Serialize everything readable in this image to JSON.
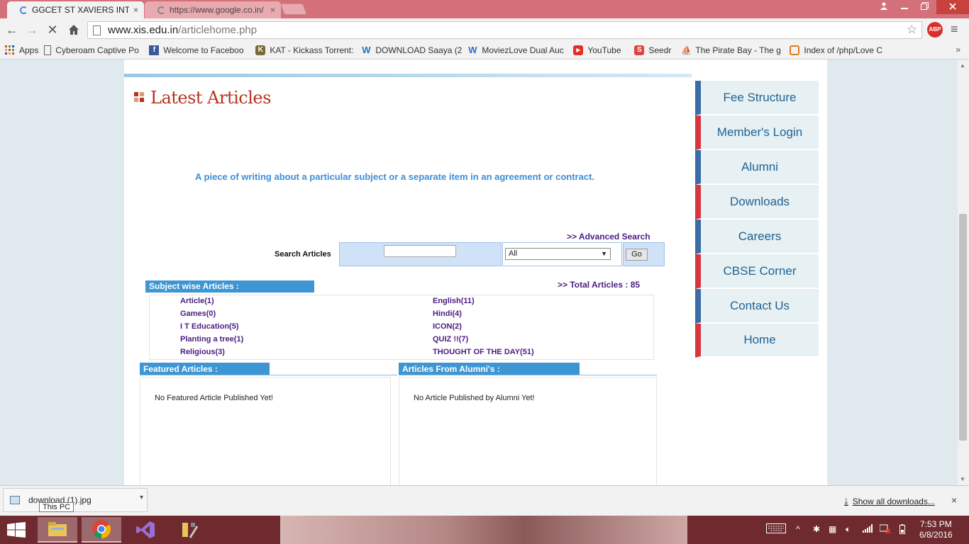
{
  "browser": {
    "tabs": [
      {
        "title": "GGCET ST XAVIERS INTER",
        "close": "×"
      },
      {
        "title": "https://www.google.co.in/",
        "close": "×"
      }
    ],
    "url_host": "www.xis.edu.in",
    "url_path": "/articlehome.php",
    "abp_label": "ABP",
    "bookmarks": [
      {
        "label": "Apps",
        "icon": "apps-grid-icon"
      },
      {
        "label": "Cyberoam Captive Po",
        "icon": "page-icon"
      },
      {
        "label": "Welcome to Faceboo",
        "icon": "facebook-icon"
      },
      {
        "label": "KAT - Kickass Torrent:",
        "icon": "kat-icon"
      },
      {
        "label": "DOWNLOAD Saaya (2",
        "icon": "w-icon"
      },
      {
        "label": "MoviezLove Dual Auc",
        "icon": "w-icon"
      },
      {
        "label": "YouTube",
        "icon": "youtube-icon"
      },
      {
        "label": "Seedr",
        "icon": "seedr-icon"
      },
      {
        "label": "The Pirate Bay - The g",
        "icon": "pirate-bay-icon"
      },
      {
        "label": "Index of /php/Love C",
        "icon": "index-icon"
      }
    ],
    "bookmarks_overflow": "»"
  },
  "page": {
    "heading": "Latest Articles",
    "tagline": "A piece of writing about a particular subject or a separate item in an agreement or contract.",
    "advanced_search": ">> Advanced Search",
    "search_label": "Search Articles",
    "search_value": "",
    "select_value": "All",
    "go_label": "Go",
    "subject_header": "Subject  wise Articles :",
    "total_articles": ">> Total Articles : 85",
    "subjects_left": [
      "Article(1)",
      "Games(0)",
      "I T Education(5)",
      "Planting a tree(1)",
      "Religious(3)"
    ],
    "subjects_right": [
      "English(11)",
      "Hindi(4)",
      "ICON(2)",
      "QUIZ !!(7)",
      "THOUGHT OF THE DAY(51)"
    ],
    "featured_header": "Featured Articles :",
    "featured_message": "No Featured Article Published Yet!",
    "alumni_header": "Articles From Alumni's :",
    "alumni_message": "No Article Published by Alumni Yet!"
  },
  "side_menu": [
    {
      "label": "Fee Structure",
      "accent": "blue"
    },
    {
      "label": "Member's Login",
      "accent": "red"
    },
    {
      "label": "Alumni",
      "accent": "blue"
    },
    {
      "label": "Downloads",
      "accent": "red"
    },
    {
      "label": "Careers",
      "accent": "blue"
    },
    {
      "label": "CBSE Corner",
      "accent": "red"
    },
    {
      "label": "Contact Us",
      "accent": "blue"
    },
    {
      "label": "Home",
      "accent": "red"
    }
  ],
  "download_bar": {
    "file": "download (1).jpg",
    "tooltip": "This PC",
    "show_all": "Show all downloads...",
    "close": "×"
  },
  "taskbar": {
    "time": "7:53 PM",
    "date": "6/8/2016"
  },
  "colors": {
    "title_bar": "#d4707a",
    "heading": "#b4341f",
    "tagline": "#3d8ed6",
    "link_purple": "#4b1d80",
    "section_blue": "#3d96d3",
    "menu_blue_accent": "#3a6ca8",
    "menu_red_accent": "#d6373d"
  }
}
